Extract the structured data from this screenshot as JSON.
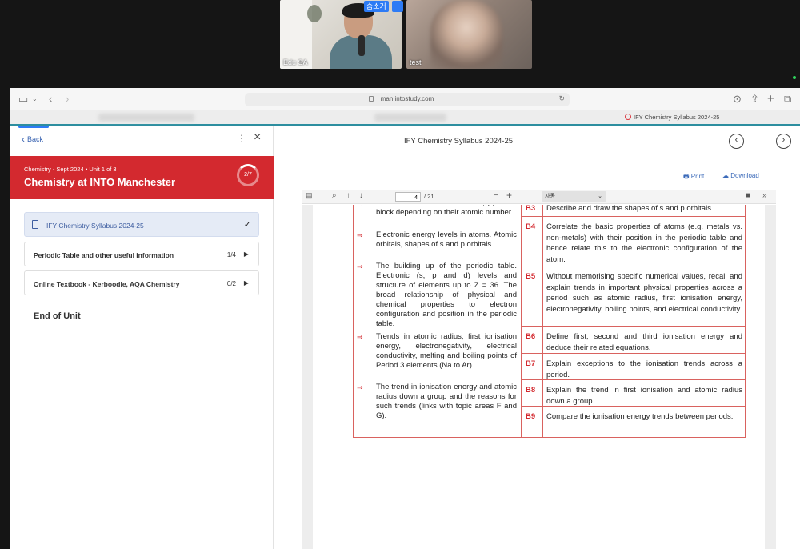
{
  "meeting": {
    "participants": [
      {
        "name": "Edu SA"
      },
      {
        "name": "test"
      }
    ],
    "speaker_tag": "숨소거",
    "more_tag": "···"
  },
  "browser": {
    "url": "man.intostudy.com",
    "active_tab": "IFY Chemistry Syllabus 2024-25"
  },
  "sidebar": {
    "back_label": "Back",
    "course_meta": "Chemistry - Sept 2024  •  Unit 1 of 3",
    "course_title": "Chemistry at INTO Manchester",
    "progress": "2/7",
    "items": [
      {
        "label": "IFY Chemistry Syllabus 2024-25",
        "status": "✓"
      },
      {
        "label": "Periodic Table and other useful information",
        "count": "1/4"
      },
      {
        "label": "Online Textbook - Kerboodle, AQA Chemistry",
        "count": "0/2"
      }
    ],
    "end_label": "End of Unit"
  },
  "viewer": {
    "title": "IFY Chemistry Syllabus 2024-25",
    "print_label": "Print",
    "download_label": "Download",
    "page_current": "4",
    "page_total": "/ 21",
    "zoom": "자동"
  },
  "syllabus": {
    "left_items": [
      {
        "text": "Classification of elements as s, p, d or f block depending on their atomic number."
      },
      {
        "text": "Electronic energy levels in atoms. Atomic orbitals, shapes of s and p orbitals."
      },
      {
        "text": "The building up of the periodic table. Electronic (s, p and d) levels and structure of elements up to Z = 36. The broad relationship of physical and chemical properties to electron configuration and position in the periodic table."
      },
      {
        "text": "Trends in atomic radius, first ionisation energy, electronegativity, electrical conductivity, melting and boiling points of Period 3 elements (Na to Ar)."
      },
      {
        "text": "The trend in ionisation energy and atomic radius down a group and the reasons for such trends (links with topic areas F and G)."
      }
    ],
    "outcomes": [
      {
        "code": "B3",
        "text": "Describe and draw the shapes of s and p orbitals."
      },
      {
        "code": "B4",
        "text": "Correlate the basic properties of atoms (e.g. metals vs. non-metals) with their position in the periodic table and hence relate this to the electronic configuration of the atom."
      },
      {
        "code": "B5",
        "text": "Without memorising specific numerical values, recall and explain trends in important physical properties across a period such as atomic radius, first ionisation energy, electronegativity, boiling points, and electrical conductivity."
      },
      {
        "code": "B6",
        "text": "Define first, second and third ionisation energy and deduce their related equations."
      },
      {
        "code": "B7",
        "text": "Explain exceptions to the ionisation trends across a period."
      },
      {
        "code": "B8",
        "text": "Explain the trend in first ionisation and atomic radius down a group."
      },
      {
        "code": "B9",
        "text": "Compare the ionisation energy trends between periods."
      }
    ],
    "arrow_glyph": "⇒"
  },
  "colors": {
    "brand_red": "#d3292f",
    "link_blue": "#3b6ab9",
    "active_item_bg": "#e5ebf6"
  }
}
